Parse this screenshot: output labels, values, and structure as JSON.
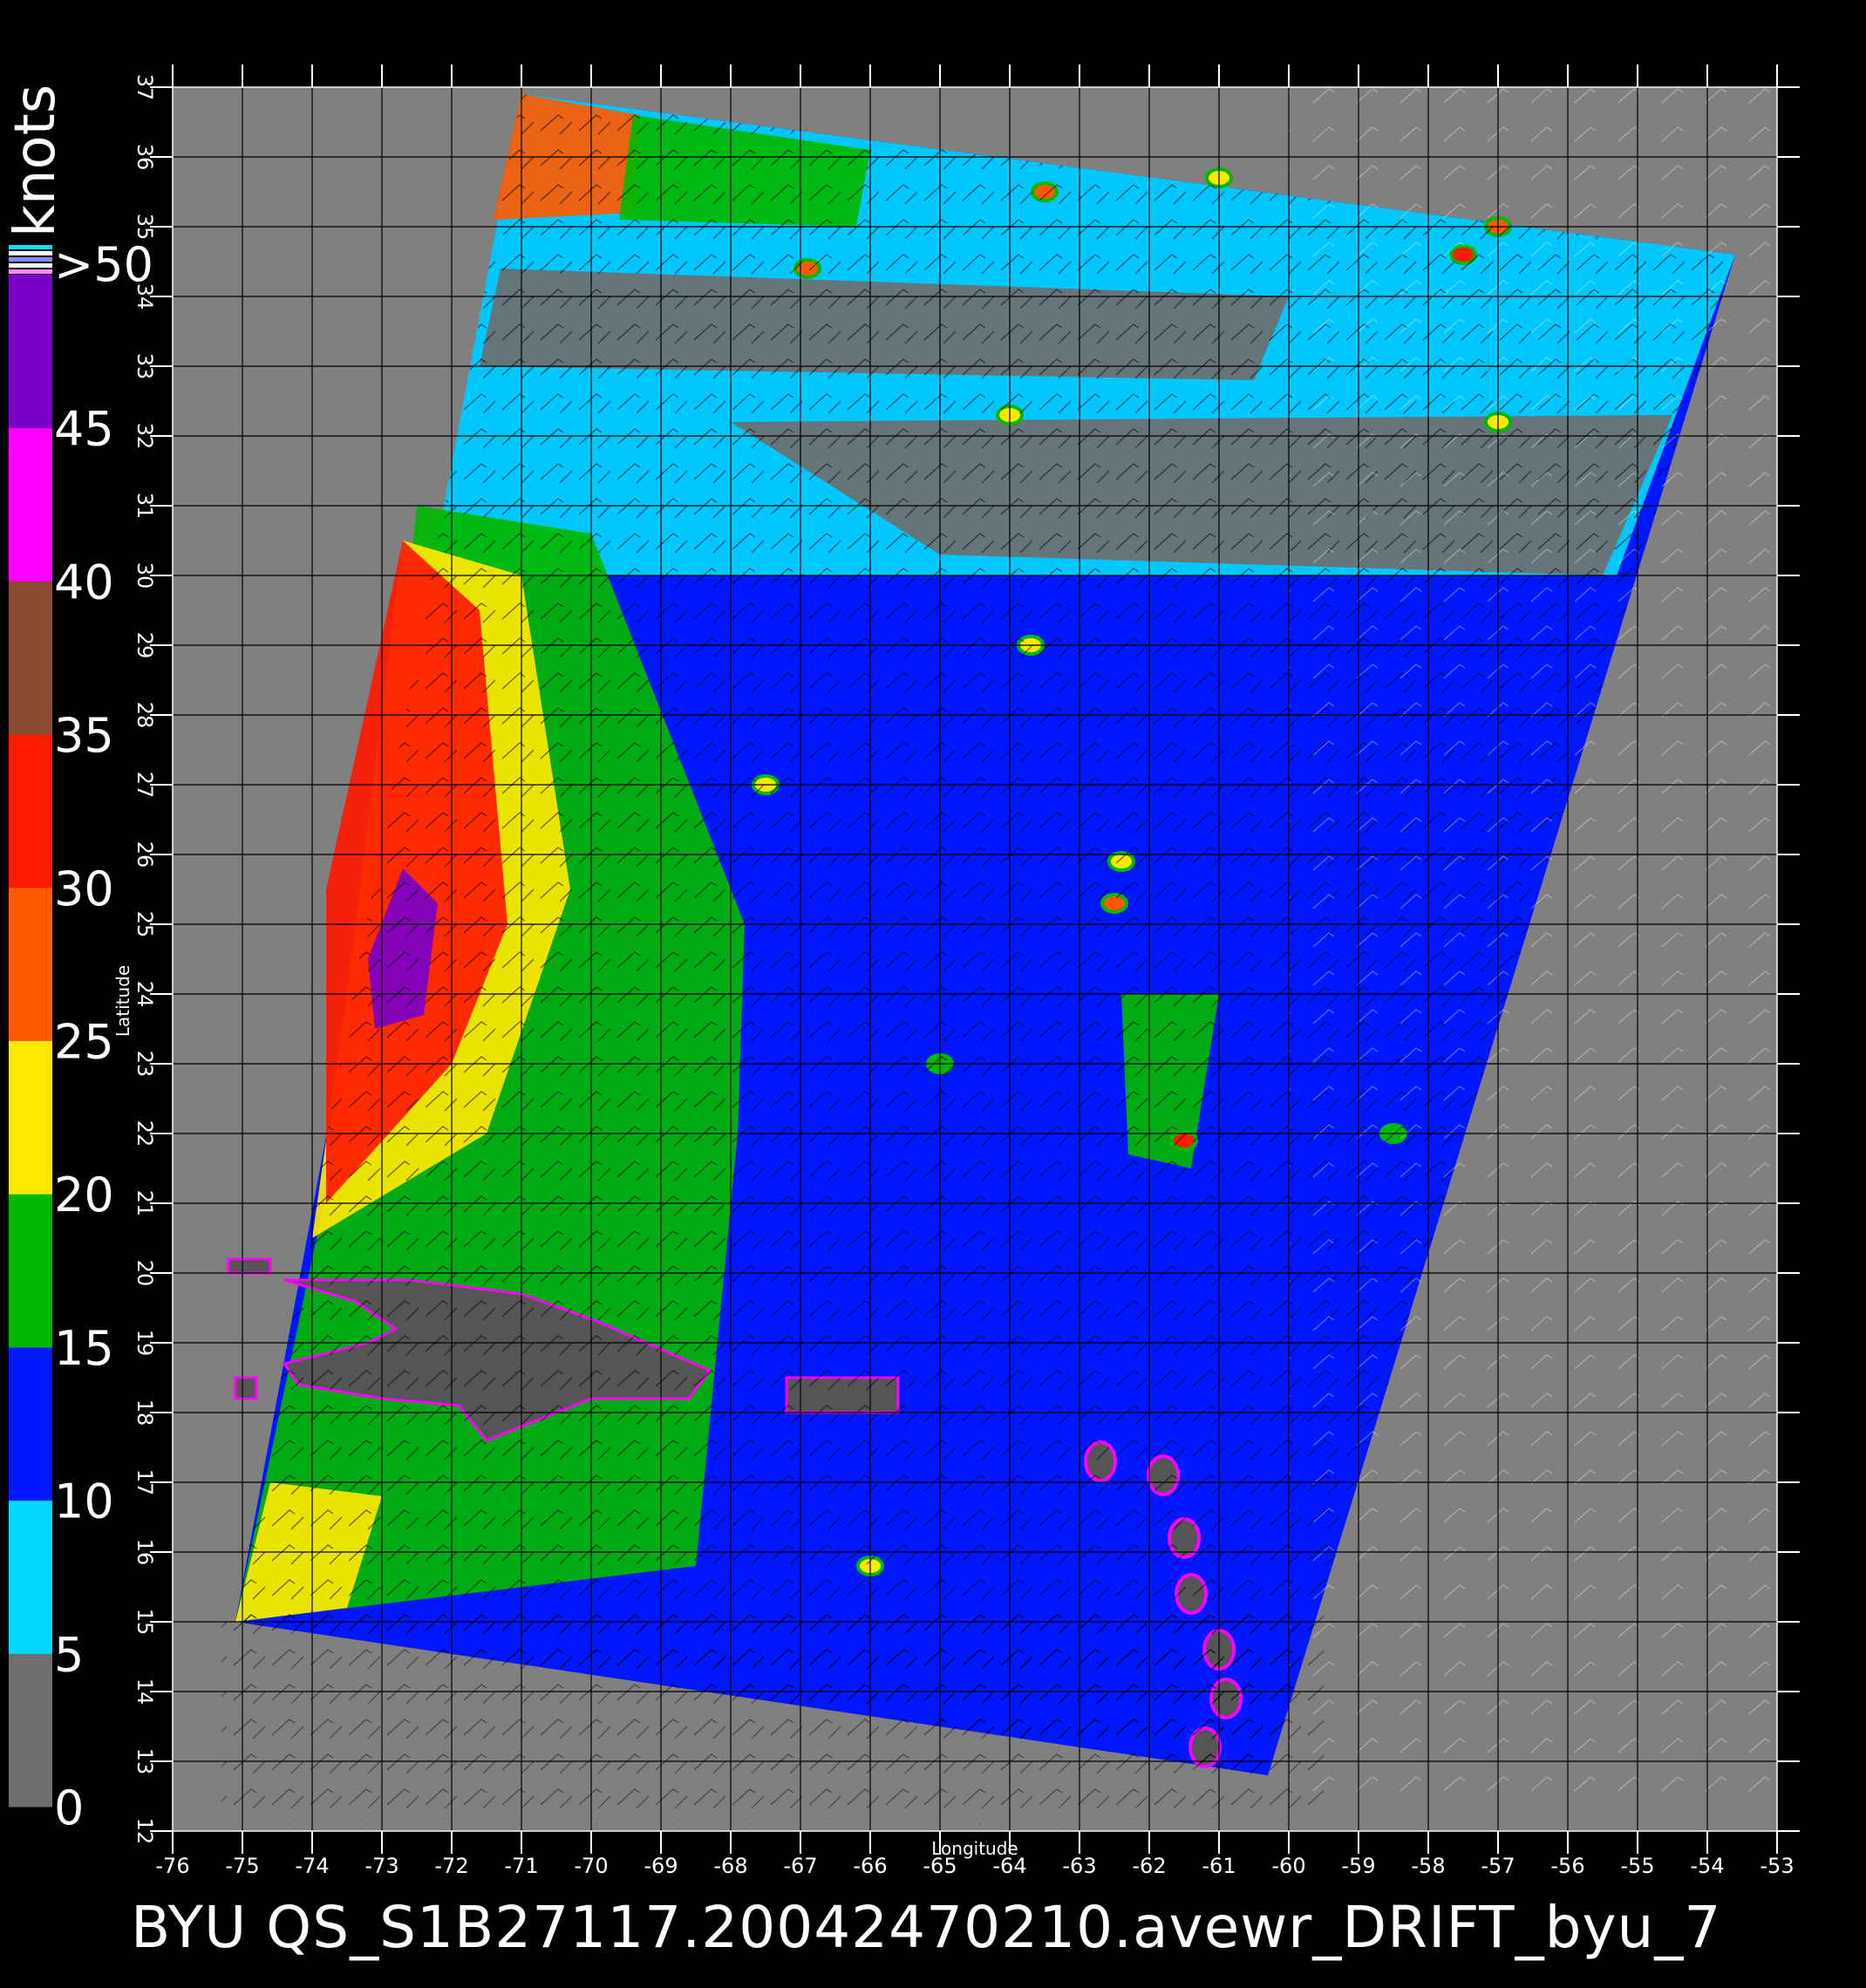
{
  "product": {
    "title": "BYU QS_S1B27117.20042470210.avewr_DRIFT_byu_7",
    "units": "knots",
    "x_axis_label": "Longitude",
    "y_axis_label": "Latitude"
  },
  "map_extent": {
    "lon_min": -76,
    "lon_max": -53,
    "lat_min": 12,
    "lat_max": 37
  },
  "x_ticks": [
    -76,
    -75,
    -74,
    -73,
    -72,
    -71,
    -70,
    -69,
    -68,
    -67,
    -66,
    -65,
    -64,
    -63,
    -62,
    -61,
    -60,
    -59,
    -58,
    -57,
    -56,
    -55,
    -54,
    -53
  ],
  "y_ticks": [
    12,
    13,
    14,
    15,
    16,
    17,
    18,
    19,
    20,
    21,
    22,
    23,
    24,
    25,
    26,
    27,
    28,
    29,
    30,
    31,
    32,
    33,
    34,
    35,
    36,
    37
  ],
  "colorbar": {
    "labels": [
      "0",
      "5",
      "10",
      "15",
      "20",
      "25",
      "30",
      "35",
      "40",
      "45",
      ">50"
    ],
    "bands": [
      {
        "from": 0,
        "to": 5,
        "color": "#6e6e6e"
      },
      {
        "from": 5,
        "to": 10,
        "color": "#00d8ff"
      },
      {
        "from": 10,
        "to": 15,
        "color": "#0018ff"
      },
      {
        "from": 15,
        "to": 20,
        "color": "#00b800"
      },
      {
        "from": 20,
        "to": 25,
        "color": "#ffe800"
      },
      {
        "from": 25,
        "to": 30,
        "color": "#ff5a00"
      },
      {
        "from": 30,
        "to": 35,
        "color": "#ff1a00"
      },
      {
        "from": 35,
        "to": 40,
        "color": "#8a4a30"
      },
      {
        "from": 40,
        "to": 45,
        "color": "#ff00ff"
      },
      {
        "from": 45,
        "to": 50,
        "color": "#7a00c8"
      }
    ]
  },
  "colors": {
    "background": "#000000",
    "no_data": "#808080",
    "land": "#555555",
    "grid": "#000000"
  },
  "swath_corners": [
    {
      "lon": -71.0,
      "lat": 36.9
    },
    {
      "lon": -53.6,
      "lat": 34.6
    },
    {
      "lon": -60.3,
      "lat": 12.8
    },
    {
      "lon": -75.1,
      "lat": 15.0
    }
  ],
  "wind_regions": [
    {
      "name": "north-strip",
      "speed": 8,
      "polygon": [
        [
          -71,
          36.9
        ],
        [
          -53.6,
          34.6
        ],
        [
          -55.3,
          30
        ],
        [
          -72.3,
          30
        ]
      ]
    },
    {
      "name": "dark-belt-1",
      "speed": 3,
      "polygon": [
        [
          -71.3,
          34.4
        ],
        [
          -60,
          34
        ],
        [
          -60.5,
          32.8
        ],
        [
          -71.6,
          33
        ]
      ]
    },
    {
      "name": "dark-belt-2",
      "speed": 3,
      "polygon": [
        [
          -68,
          32.2
        ],
        [
          -54.5,
          32.3
        ],
        [
          -55.5,
          30
        ],
        [
          -65,
          30.3
        ]
      ]
    },
    {
      "name": "northwest-orange",
      "speed": 27,
      "polygon": [
        [
          -71,
          36.9
        ],
        [
          -69.3,
          36.6
        ],
        [
          -69.4,
          35.2
        ],
        [
          -71.4,
          35.1
        ]
      ]
    },
    {
      "name": "north-green",
      "speed": 17,
      "polygon": [
        [
          -69.4,
          36.6
        ],
        [
          -66,
          36.1
        ],
        [
          -66.2,
          35
        ],
        [
          -69.6,
          35.1
        ]
      ]
    },
    {
      "name": "central-blue",
      "speed": 12,
      "polygon": [
        [
          -72.3,
          30
        ],
        [
          -55.3,
          30
        ],
        [
          -60.3,
          12.8
        ],
        [
          -75.1,
          15
        ]
      ]
    },
    {
      "name": "west-green",
      "speed": 18,
      "polygon": [
        [
          -72.5,
          31
        ],
        [
          -70,
          30.6
        ],
        [
          -67.8,
          25
        ],
        [
          -67.9,
          22
        ],
        [
          -68.5,
          15.8
        ],
        [
          -75.1,
          15
        ],
        [
          -73.2,
          24
        ]
      ]
    },
    {
      "name": "west-yellow",
      "speed": 23,
      "polygon": [
        [
          -72.7,
          30.5
        ],
        [
          -71,
          30
        ],
        [
          -70.3,
          25.5
        ],
        [
          -71.5,
          22
        ],
        [
          -74,
          20.5
        ],
        [
          -73.5,
          24
        ]
      ]
    },
    {
      "name": "west-red",
      "speed": 31,
      "polygon": [
        [
          -72.7,
          30.5
        ],
        [
          -71.6,
          29.5
        ],
        [
          -71.2,
          25
        ],
        [
          -72,
          23
        ],
        [
          -73.8,
          21
        ],
        [
          -73.8,
          25.5
        ]
      ]
    },
    {
      "name": "west-purple",
      "speed": 46,
      "polygon": [
        [
          -72.7,
          25.8
        ],
        [
          -72.2,
          25.3
        ],
        [
          -72.4,
          23.7
        ],
        [
          -73.1,
          23.5
        ],
        [
          -73.2,
          24.5
        ]
      ]
    },
    {
      "name": "southwest-yellow",
      "speed": 22,
      "polygon": [
        [
          -74.6,
          17
        ],
        [
          -73,
          16.8
        ],
        [
          -73.5,
          15.2
        ],
        [
          -75.1,
          15
        ]
      ]
    },
    {
      "name": "east-green-patch",
      "speed": 17,
      "polygon": [
        [
          -62.4,
          24
        ],
        [
          -61,
          24
        ],
        [
          -61.4,
          21.5
        ],
        [
          -62.3,
          21.7
        ]
      ]
    }
  ],
  "land_masses": [
    {
      "name": "hispaniola",
      "polygon": [
        [
          -74.4,
          19.9
        ],
        [
          -72.6,
          19.9
        ],
        [
          -71,
          19.7
        ],
        [
          -69.9,
          19.3
        ],
        [
          -68.3,
          18.6
        ],
        [
          -68.6,
          18.2
        ],
        [
          -70,
          18.2
        ],
        [
          -71,
          17.8
        ],
        [
          -71.5,
          17.6
        ],
        [
          -71.9,
          18.1
        ],
        [
          -73,
          18.2
        ],
        [
          -74.2,
          18.4
        ],
        [
          -74.4,
          18.7
        ],
        [
          -73.2,
          19.0
        ],
        [
          -72.8,
          19.2
        ],
        [
          -73.4,
          19.6
        ]
      ]
    },
    {
      "name": "puerto-rico",
      "polygon": [
        [
          -67.2,
          18.5
        ],
        [
          -65.6,
          18.5
        ],
        [
          -65.6,
          18.0
        ],
        [
          -67.2,
          18.0
        ]
      ]
    },
    {
      "name": "cuba-tip",
      "polygon": [
        [
          -75.2,
          20.2
        ],
        [
          -74.6,
          20.2
        ],
        [
          -74.6,
          20.0
        ],
        [
          -75.2,
          20.0
        ]
      ]
    },
    {
      "name": "jamaica-edge",
      "polygon": [
        [
          -75.1,
          18.5
        ],
        [
          -74.8,
          18.5
        ],
        [
          -74.8,
          18.2
        ],
        [
          -75.1,
          18.2
        ]
      ]
    }
  ],
  "islands": [
    {
      "name": "guadeloupe",
      "lon": -61.5,
      "lat": 16.2
    },
    {
      "name": "dominica",
      "lon": -61.4,
      "lat": 15.4
    },
    {
      "name": "martinique",
      "lon": -61.0,
      "lat": 14.6
    },
    {
      "name": "st-lucia",
      "lon": -60.9,
      "lat": 13.9
    },
    {
      "name": "st-vincent",
      "lon": -61.2,
      "lat": 13.2
    },
    {
      "name": "antigua",
      "lon": -61.8,
      "lat": 17.1
    },
    {
      "name": "st-kitts",
      "lon": -62.7,
      "lat": 17.3
    }
  ],
  "hotspots": [
    {
      "lon": -66.9,
      "lat": 34.4,
      "speed": 28
    },
    {
      "lon": -63.5,
      "lat": 35.5,
      "speed": 25
    },
    {
      "lon": -57.5,
      "lat": 34.6,
      "speed": 30
    },
    {
      "lon": -57.0,
      "lat": 35.0,
      "speed": 26
    },
    {
      "lon": -61.0,
      "lat": 35.7,
      "speed": 22
    },
    {
      "lon": -64.0,
      "lat": 32.3,
      "speed": 24
    },
    {
      "lon": -57.0,
      "lat": 32.2,
      "speed": 22
    },
    {
      "lon": -62.5,
      "lat": 25.3,
      "speed": 26
    },
    {
      "lon": -61.5,
      "lat": 21.9,
      "speed": 30
    },
    {
      "lon": -62.4,
      "lat": 25.9,
      "speed": 23
    },
    {
      "lon": -66.0,
      "lat": 15.8,
      "speed": 21
    },
    {
      "lon": -63.7,
      "lat": 29.0,
      "speed": 20
    },
    {
      "lon": -65.0,
      "lat": 23.0,
      "speed": 19
    },
    {
      "lon": -58.5,
      "lat": 22.0,
      "speed": 18
    },
    {
      "lon": -67.5,
      "lat": 27.0,
      "speed": 22
    }
  ]
}
